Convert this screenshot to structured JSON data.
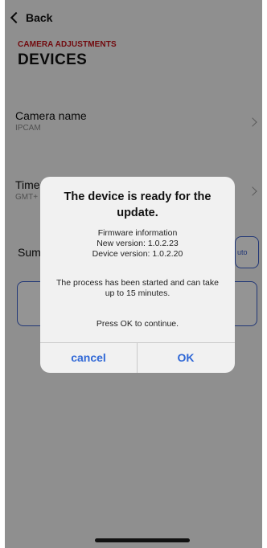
{
  "nav": {
    "back_label": "Back"
  },
  "header": {
    "overline": "CAMERA ADJUSTMENTS",
    "title": "DEVICES"
  },
  "settings": {
    "camera_name": {
      "label": "Camera name",
      "value": "IPCAM"
    },
    "timezone": {
      "label": "Timez",
      "value": "GMT+"
    },
    "summer_time": {
      "label": "Sum",
      "auto_button_label": "uto"
    }
  },
  "dialog": {
    "title": "The device is ready for the update.",
    "firmware_heading": "Firmware information",
    "new_version": "New version: 1.0.2.23",
    "device_version": "Device version: 1.0.2.20",
    "process_text": "The process has been started and can take up to 15 minutes.",
    "continue_text": "Press OK to continue.",
    "cancel_label": "cancel",
    "ok_label": "OK"
  },
  "colors": {
    "accent": "#c4141b",
    "link_blue": "#2f67d6",
    "outline_blue": "#3a5fcd"
  }
}
